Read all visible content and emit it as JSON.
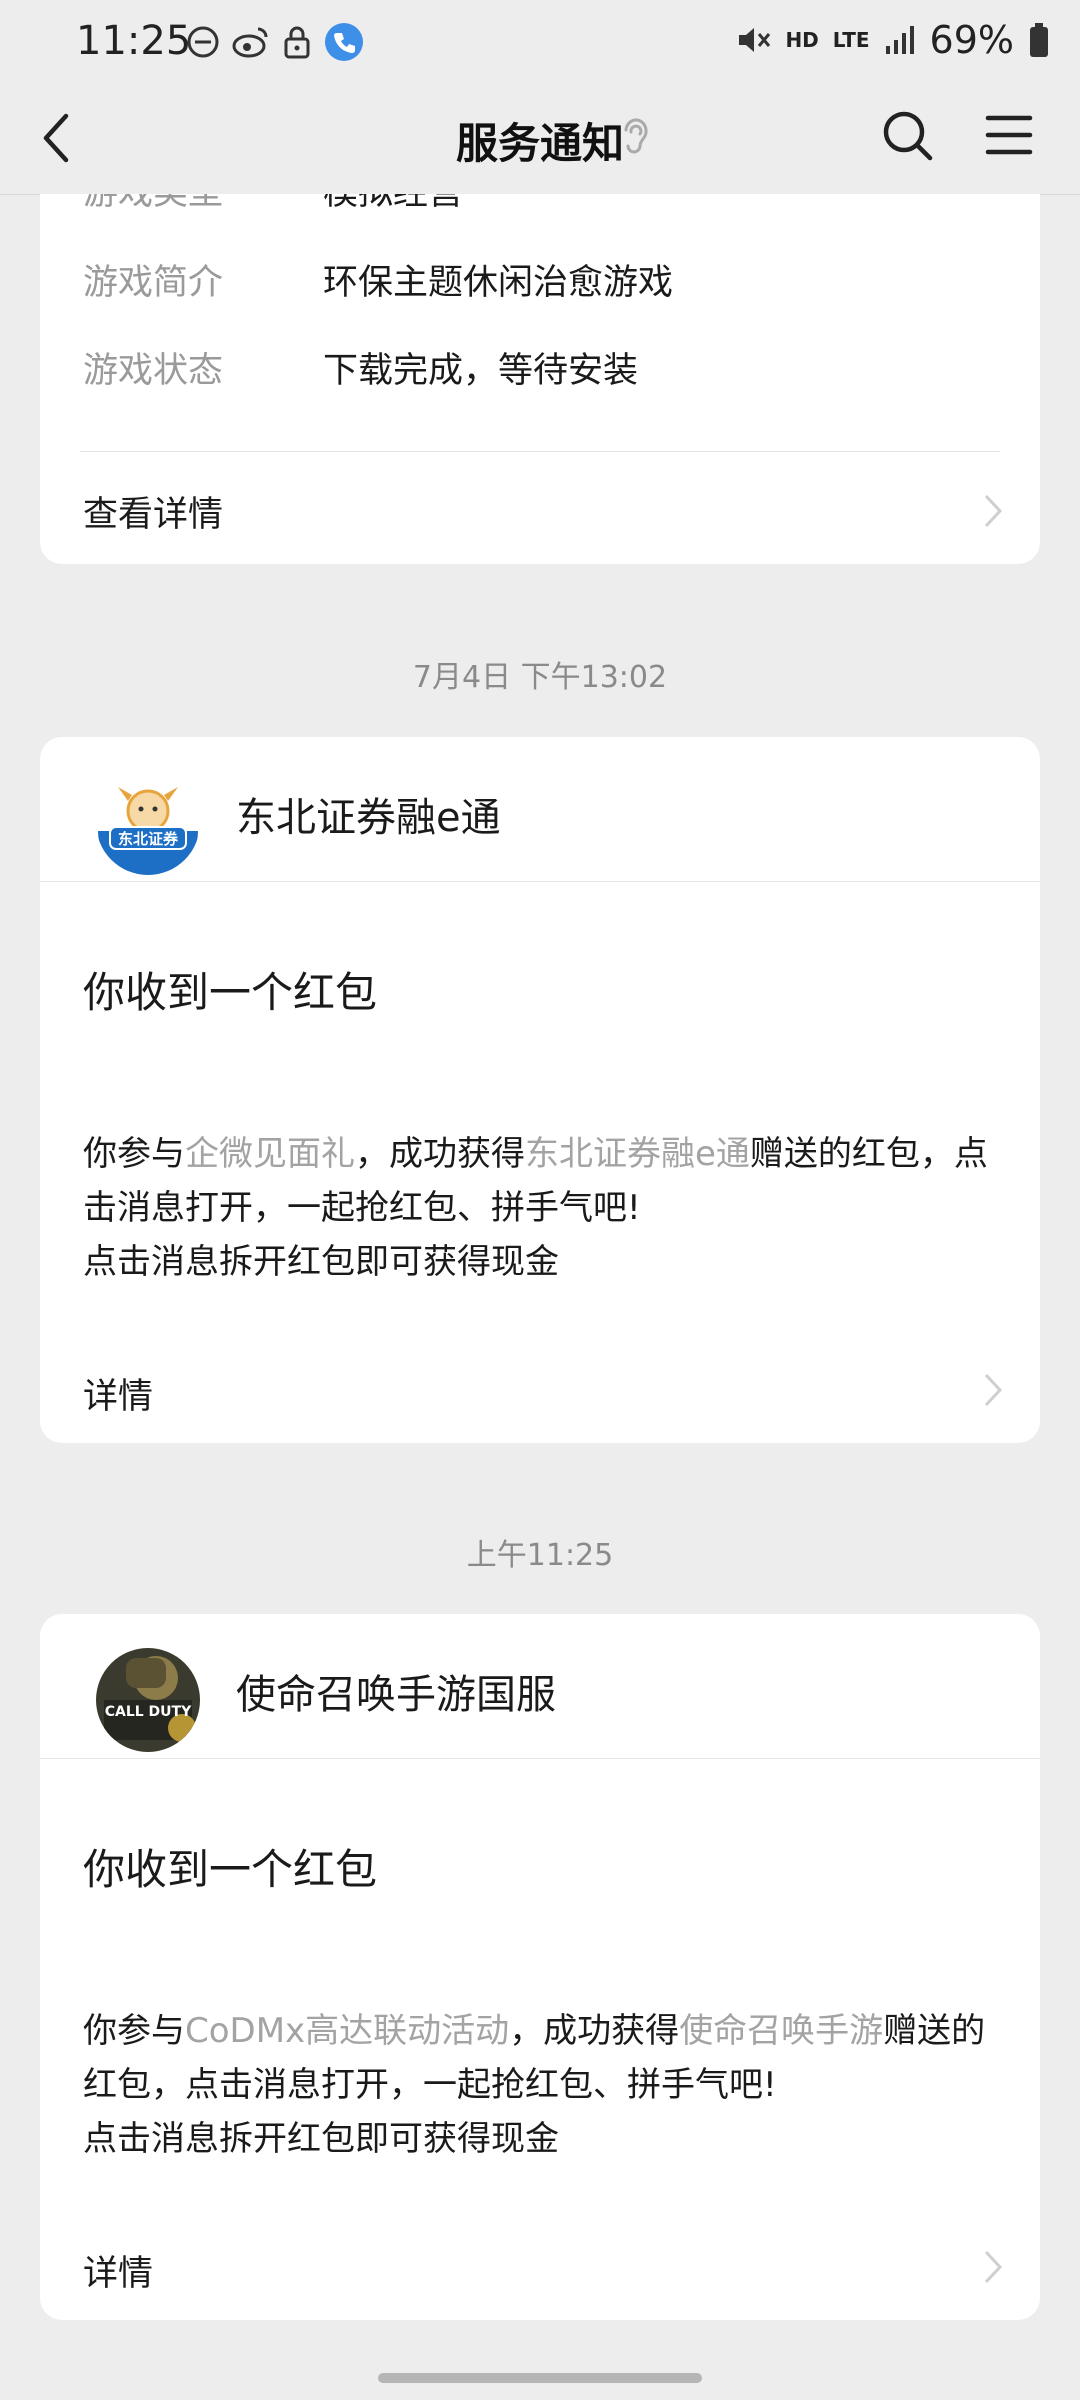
{
  "status_bar": {
    "time": "11:25",
    "battery": "69%",
    "network": "LTE",
    "hd": "HD"
  },
  "nav": {
    "title": "服务通知"
  },
  "card1": {
    "partial_row": {
      "key": "游戏类型",
      "value": "模拟经营"
    },
    "rows": [
      {
        "key": "游戏简介",
        "value": "环保主题休闲治愈游戏"
      },
      {
        "key": "游戏状态",
        "value": "下载完成，等待安装"
      }
    ],
    "detail_label": "查看详情"
  },
  "msg1": {
    "timestamp": "7月4日 下午13:02",
    "account": "东北证券融e通",
    "avatar_text": "东北证券",
    "title": "你收到一个红包",
    "body": {
      "p1": "你参与",
      "link1": "企微见面礼",
      "p2": "，成功获得",
      "link2": "东北证券融e通",
      "p3": "赠送的红包，点击消息打开，一起抢红包、拼手气吧!",
      "line2": "点击消息拆开红包即可获得现金"
    },
    "detail_label": "详情"
  },
  "msg2": {
    "timestamp": "上午11:25",
    "account": "使命召唤手游国服",
    "avatar_text": "CALL DUTY",
    "title": "你收到一个红包",
    "body": {
      "p1": "你参与",
      "link1": "CoDMx高达联动活动",
      "p2": "，成功获得",
      "link2": "使命召唤手游",
      "p3": "赠送的红包，点击消息打开，一起抢红包、拼手气吧!",
      "line2": "点击消息拆开红包即可获得现金"
    },
    "detail_label": "详情"
  },
  "colors": {
    "background": "#ededed",
    "card": "#ffffff",
    "muted_text": "#9a9a9a",
    "highlight_text": "#a3a3a3"
  }
}
